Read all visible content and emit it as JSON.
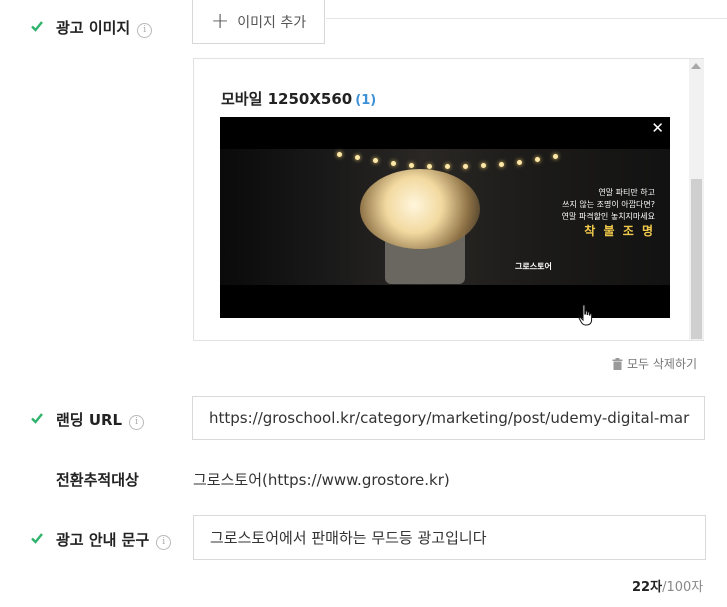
{
  "ad_image": {
    "label": "광고 이미지",
    "info_icon": "i",
    "add_button": "이미지 추가",
    "section": {
      "title": "모바일 1250X560",
      "count": "(1)",
      "preview": {
        "close": "✕",
        "line1": "연말 파티만 하고",
        "line2": "쓰지 않는 조명이 아깝다면?",
        "line3": "연말 파격할인 놓치지마세요",
        "cta": "착 불 조 명",
        "brand": "그로스토어"
      }
    },
    "delete_all": "모두 삭제하기"
  },
  "landing_url": {
    "label": "랜딩 URL",
    "info_icon": "i",
    "value": "https://groschool.kr/category/marketing/post/udemy-digital-mar"
  },
  "conversion_target": {
    "label": "전환추적대상",
    "value": "그로스토어(https://www.grostore.kr)"
  },
  "ad_copy": {
    "label": "광고 안내 문구",
    "info_icon": "i",
    "value": "그로스토어에서 판매하는 무드등 광고입니다",
    "count_current": "22자",
    "count_max": "/100자"
  },
  "colors": {
    "check": "#2fb36b",
    "accent": "#3d8fd6",
    "cta_yellow": "#f0c94a"
  }
}
